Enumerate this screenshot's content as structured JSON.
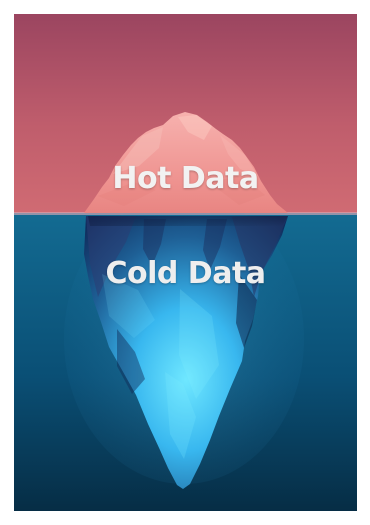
{
  "image": {
    "labels": {
      "hot": "Hot Data",
      "cold": "Cold Data"
    },
    "colors": {
      "sky_top": "#a44f68",
      "sky_bottom": "#cc6571",
      "water_top": "#0f5f89",
      "water_bottom": "#073147",
      "iceberg_above": "#f3a0a3",
      "iceberg_below": "#5bd6ff"
    }
  }
}
